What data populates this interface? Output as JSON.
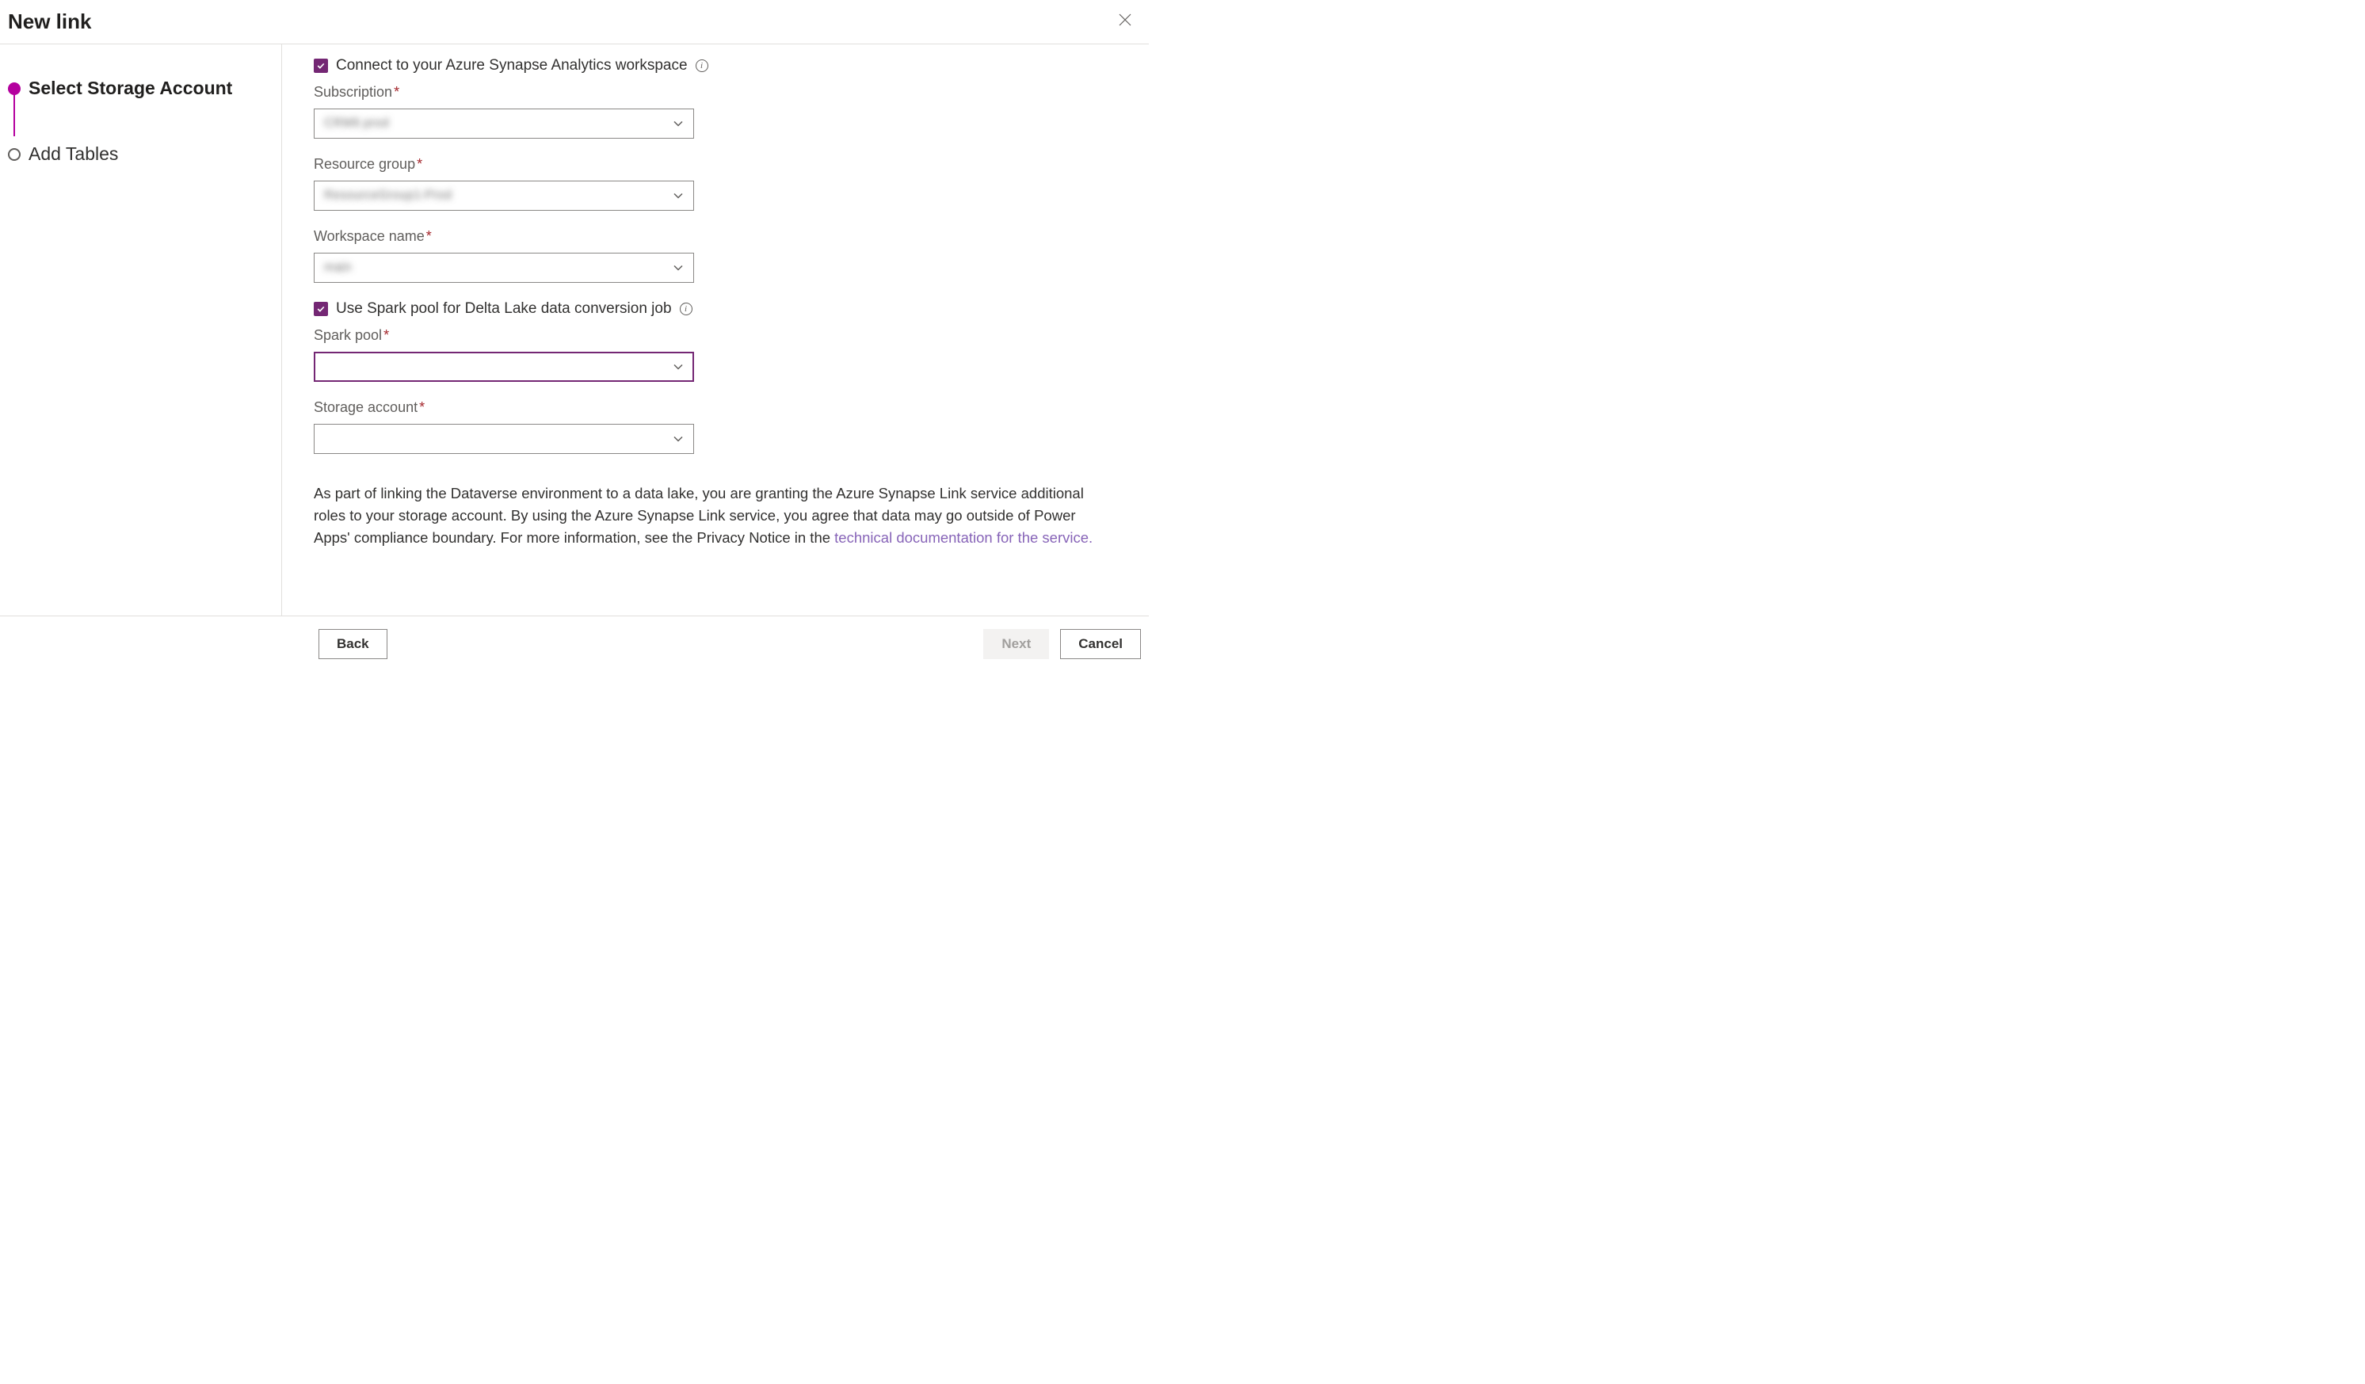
{
  "header": {
    "title": "New link"
  },
  "sidebar": {
    "steps": [
      {
        "label": "Select Storage Account",
        "active": true
      },
      {
        "label": "Add Tables",
        "active": false
      }
    ]
  },
  "form": {
    "connect_checkbox": {
      "label": "Connect to your Azure Synapse Analytics workspace",
      "checked": true
    },
    "subscription": {
      "label": "Subscription",
      "value": "CRM6 prod"
    },
    "resourcegroup": {
      "label": "Resource group",
      "value": "ResourceGroup1-Prod"
    },
    "workspace": {
      "label": "Workspace name",
      "value": "main"
    },
    "sparkpool_checkbox": {
      "label": "Use Spark pool for Delta Lake data conversion job",
      "checked": true
    },
    "sparkpool": {
      "label": "Spark pool",
      "value": ""
    },
    "storage": {
      "label": "Storage account",
      "value": ""
    },
    "disclaimer_pre": "As part of linking the Dataverse environment to a data lake, you are granting the Azure Synapse Link service additional roles to your storage account. By using the Azure Synapse Link service, you agree that data may go outside of Power Apps' compliance boundary. For more information, see the Privacy Notice in the ",
    "disclaimer_link": "technical documentation for the service."
  },
  "footer": {
    "back": "Back",
    "next": "Next",
    "cancel": "Cancel"
  }
}
